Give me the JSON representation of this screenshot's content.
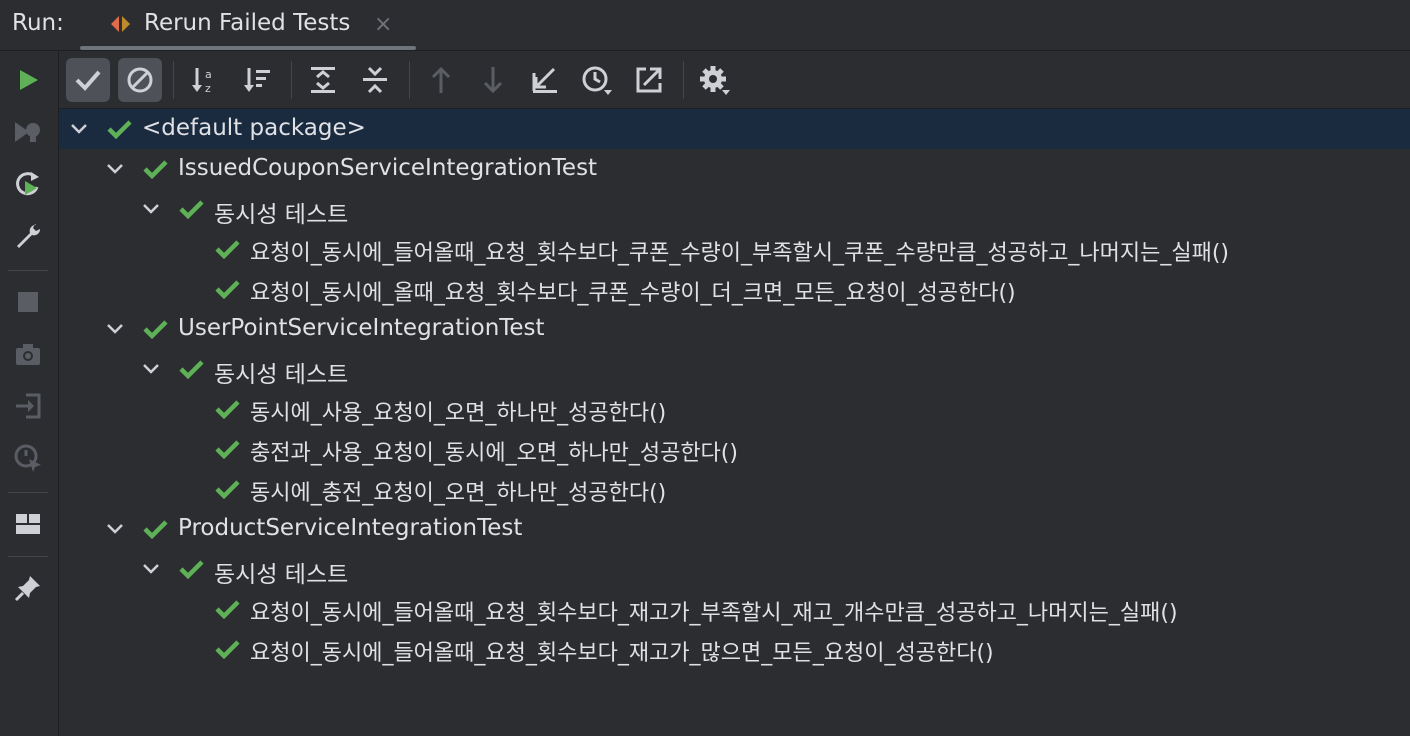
{
  "run_panel": {
    "label": "Run:",
    "tab_title": "Rerun Failed Tests",
    "tab_close": "×"
  },
  "colors": {
    "background": "#2b2d30",
    "selection": "#1a2a3f",
    "pass_green": "#5fb157",
    "run_green": "#5fb157",
    "icon_gray": "#ced0d6",
    "disabled_gray": "#6f737a"
  },
  "left_toolbar": [
    {
      "icon": "run-icon"
    },
    {
      "icon": "debug-icon"
    },
    {
      "icon": "rerun-icon"
    },
    {
      "icon": "wrench-icon"
    },
    {
      "icon": "stop-icon"
    },
    {
      "icon": "camera-icon"
    },
    {
      "icon": "login-icon"
    },
    {
      "icon": "coverage-icon"
    },
    {
      "icon": "layout-icon"
    },
    {
      "icon": "pin-icon"
    }
  ],
  "toolbar": [
    {
      "icon": "show-passed-icon",
      "toggled": true
    },
    {
      "icon": "show-ignored-icon",
      "toggled": true
    },
    {
      "icon": "sort-alpha-icon"
    },
    {
      "icon": "sort-duration-icon"
    },
    {
      "icon": "expand-all-icon"
    },
    {
      "icon": "collapse-all-icon"
    },
    {
      "icon": "arrow-up-icon"
    },
    {
      "icon": "arrow-down-icon"
    },
    {
      "icon": "import-tests-icon"
    },
    {
      "icon": "history-icon"
    },
    {
      "icon": "export-icon"
    },
    {
      "icon": "settings-icon"
    }
  ],
  "tree": [
    {
      "label": "<default package>",
      "level": 0,
      "expanded": true,
      "status": "passed",
      "selected": true
    },
    {
      "label": "IssuedCouponServiceIntegrationTest",
      "level": 1,
      "expanded": true,
      "status": "passed"
    },
    {
      "label": "동시성 테스트",
      "level": 2,
      "expanded": true,
      "status": "passed"
    },
    {
      "label": "요청이_동시에_들어올때_요청_횟수보다_쿠폰_수량이_부족할시_쿠폰_수량만큼_성공하고_나머지는_실패()",
      "level": 3,
      "status": "passed"
    },
    {
      "label": "요청이_동시에_올때_요청_횟수보다_쿠폰_수량이_더_크면_모든_요청이_성공한다()",
      "level": 3,
      "status": "passed"
    },
    {
      "label": "UserPointServiceIntegrationTest",
      "level": 1,
      "expanded": true,
      "status": "passed"
    },
    {
      "label": "동시성 테스트",
      "level": 2,
      "expanded": true,
      "status": "passed"
    },
    {
      "label": "동시에_사용_요청이_오면_하나만_성공한다()",
      "level": 3,
      "status": "passed"
    },
    {
      "label": "충전과_사용_요청이_동시에_오면_하나만_성공한다()",
      "level": 3,
      "status": "passed"
    },
    {
      "label": "동시에_충전_요청이_오면_하나만_성공한다()",
      "level": 3,
      "status": "passed"
    },
    {
      "label": "ProductServiceIntegrationTest",
      "level": 1,
      "expanded": true,
      "status": "passed"
    },
    {
      "label": "동시성 테스트",
      "level": 2,
      "expanded": true,
      "status": "passed"
    },
    {
      "label": "요청이_동시에_들어올때_요청_횟수보다_재고가_부족할시_재고_개수만큼_성공하고_나머지는_실패()",
      "level": 3,
      "status": "passed"
    },
    {
      "label": "요청이_동시에_들어올때_요청_횟수보다_재고가_많으면_모든_요청이_성공한다()",
      "level": 3,
      "status": "passed"
    }
  ]
}
